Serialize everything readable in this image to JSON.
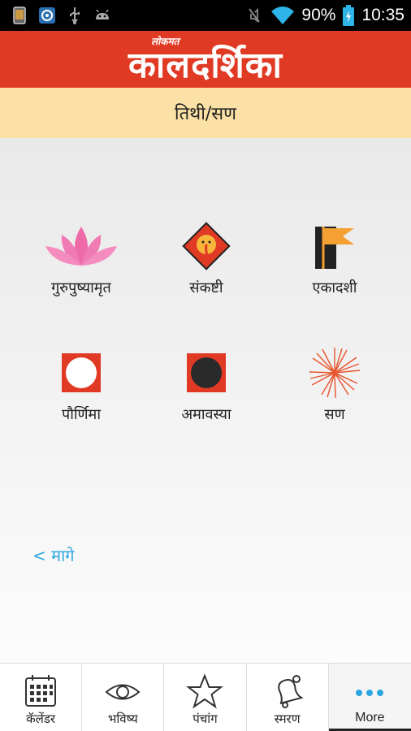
{
  "status_bar": {
    "battery_percent": "90%",
    "time": "10:35"
  },
  "header": {
    "brand_small": "लोकमत",
    "title": "कालदर्शिका"
  },
  "sub_header": {
    "title": "तिथी/सण"
  },
  "grid": [
    {
      "label": "गुरुपुष्यामृत",
      "icon": "lotus-icon"
    },
    {
      "label": "संकष्टी",
      "icon": "ganesha-icon"
    },
    {
      "label": "एकादशी",
      "icon": "flag-icon"
    },
    {
      "label": "पौर्णिमा",
      "icon": "full-moon-icon"
    },
    {
      "label": "अमावस्या",
      "icon": "new-moon-icon"
    },
    {
      "label": "सण",
      "icon": "firework-icon"
    }
  ],
  "back_link": "< मागे",
  "bottom_nav": [
    {
      "label": "कॅलेंडर",
      "icon": "calendar-icon"
    },
    {
      "label": "भविष्य",
      "icon": "eye-icon"
    },
    {
      "label": "पंचांग",
      "icon": "star-icon"
    },
    {
      "label": "स्मरण",
      "icon": "bell-icon"
    },
    {
      "label": "More",
      "icon": "more-icon"
    }
  ],
  "colors": {
    "header_red": "#e03a24",
    "sub_header_yellow": "#fbe1a5",
    "link_blue": "#2ba6e0",
    "wifi_blue": "#2fb4e8"
  }
}
